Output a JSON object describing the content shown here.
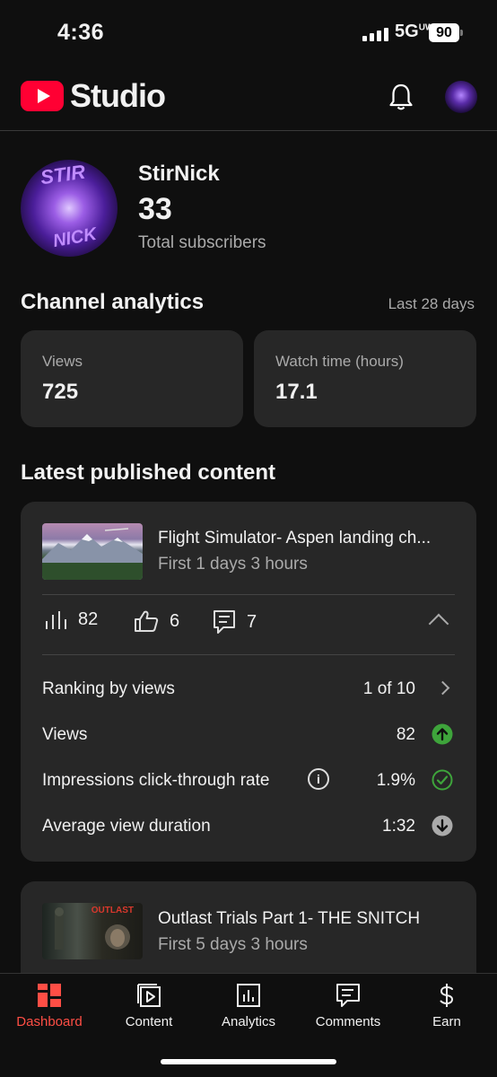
{
  "status": {
    "time": "4:36",
    "network": "5G",
    "network_sup": "UW",
    "battery": "90"
  },
  "header": {
    "brand": "Studio"
  },
  "channel": {
    "name": "StirNick",
    "subscribers": "33",
    "subscribers_label": "Total subscribers",
    "avatar_text_top": "STIR",
    "avatar_text_bottom": "NICK"
  },
  "analytics": {
    "title": "Channel analytics",
    "period": "Last 28 days",
    "cards": [
      {
        "label": "Views",
        "value": "725"
      },
      {
        "label": "Watch time (hours)",
        "value": "17.1"
      }
    ]
  },
  "latest": {
    "title": "Latest published content",
    "videos": [
      {
        "title": "Flight Simulator- Aspen landing ch...",
        "subtitle": "First 1 days 3 hours",
        "views": "82",
        "likes": "6",
        "comments": "7",
        "rows": [
          {
            "label": "Ranking by views",
            "value": "1 of 10",
            "icon": "chevron-right-icon"
          },
          {
            "label": "Views",
            "value": "82",
            "icon": "arrow-up-green-icon"
          },
          {
            "label": "Impressions click-through rate",
            "value": "1.9%",
            "icon": "check-circle-green-icon"
          },
          {
            "label": "Average view duration",
            "value": "1:32",
            "icon": "arrow-down-gray-icon"
          }
        ]
      },
      {
        "title": "Outlast Trials Part 1- THE SNITCH",
        "subtitle": "First 5 days 3 hours",
        "thumb_text": "OUTLAST"
      }
    ]
  },
  "nav": {
    "items": [
      {
        "label": "Dashboard",
        "icon": "dashboard-icon",
        "active": true
      },
      {
        "label": "Content",
        "icon": "content-icon"
      },
      {
        "label": "Analytics",
        "icon": "analytics-icon"
      },
      {
        "label": "Comments",
        "icon": "comments-icon"
      },
      {
        "label": "Earn",
        "icon": "dollar-icon"
      }
    ]
  },
  "colors": {
    "accent": "#ff0033",
    "active_nav": "#ff4e45",
    "success": "#3ea43b",
    "card": "#272727",
    "background": "#0f0f0f"
  }
}
